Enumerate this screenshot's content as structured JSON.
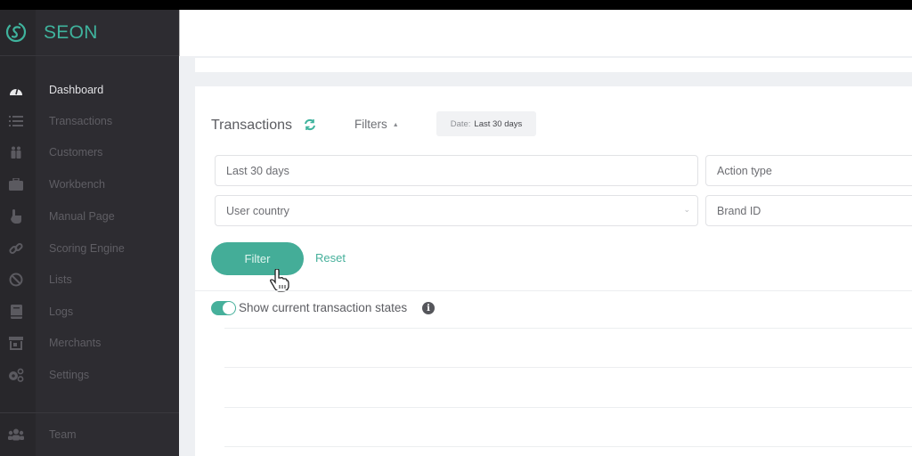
{
  "brand": {
    "name": "SEON",
    "accent": "#3fb39d"
  },
  "sidebar": {
    "items": [
      {
        "label": "Dashboard",
        "icon": "dashboard-gauge-icon",
        "active": true
      },
      {
        "label": "Transactions",
        "icon": "list-icon"
      },
      {
        "label": "Customers",
        "icon": "customers-icon"
      },
      {
        "label": "Workbench",
        "icon": "briefcase-icon"
      },
      {
        "label": "Manual Page",
        "icon": "hand-pointer-icon"
      },
      {
        "label": "Scoring Engine",
        "icon": "link-icon"
      },
      {
        "label": "Lists",
        "icon": "ban-icon"
      },
      {
        "label": "Logs",
        "icon": "book-icon"
      },
      {
        "label": "Merchants",
        "icon": "store-icon"
      },
      {
        "label": "Settings",
        "icon": "gears-icon"
      }
    ],
    "footer_items": [
      {
        "label": "Team",
        "icon": "team-icon"
      }
    ]
  },
  "main": {
    "title": "Transactions",
    "filters_label": "Filters",
    "date_chip": {
      "key": "Date:",
      "value": "Last 30 days"
    },
    "fields": {
      "date_range": {
        "value": "Last 30 days"
      },
      "action_type": {
        "placeholder": "Action type"
      },
      "user_country": {
        "placeholder": "User country"
      },
      "brand_id": {
        "placeholder": "Brand ID"
      }
    },
    "filter_button": "Filter",
    "reset_button": "Reset",
    "toggle": {
      "label": "Show current transaction states",
      "on": true
    }
  }
}
